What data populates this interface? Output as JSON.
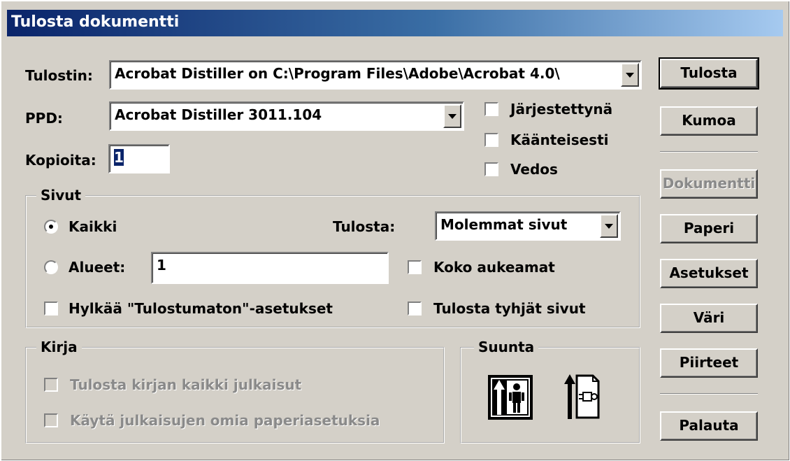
{
  "window": {
    "title": "Tulosta dokumentti"
  },
  "printer": {
    "label": "Tulostin:",
    "value": "Acrobat Distiller on C:\\Program Files\\Adobe\\Acrobat 4.0\\"
  },
  "ppd": {
    "label": "PPD:",
    "value": "Acrobat Distiller 3011.104"
  },
  "copies": {
    "label": "Kopioita:",
    "value": "1"
  },
  "options": {
    "collate": "Järjestettynä",
    "reverse": "Käänteisesti",
    "proof": "Vedos"
  },
  "pages": {
    "group_title": "Sivut",
    "all_label": "Kaikki",
    "ranges_label": "Alueet:",
    "ranges_value": "1",
    "print_label": "Tulosta:",
    "print_value": "Molemmat sivut",
    "spreads_label": "Koko aukeamat",
    "ignore_label": "Hylkää \"Tulostumaton\"-asetukset",
    "blank_label": "Tulosta tyhjät sivut"
  },
  "book": {
    "group_title": "Kirja",
    "all_publications": "Tulosta kirjan kaikki julkaisut",
    "paper_settings": "Käytä julkaisujen omia paperiasetuksia"
  },
  "orientation": {
    "group_title": "Suunta"
  },
  "buttons": {
    "print": "Tulosta",
    "cancel": "Kumoa",
    "document": "Dokumentti",
    "paper": "Paperi",
    "settings": "Asetukset",
    "color": "Väri",
    "features": "Piirteet",
    "reset": "Palauta"
  }
}
